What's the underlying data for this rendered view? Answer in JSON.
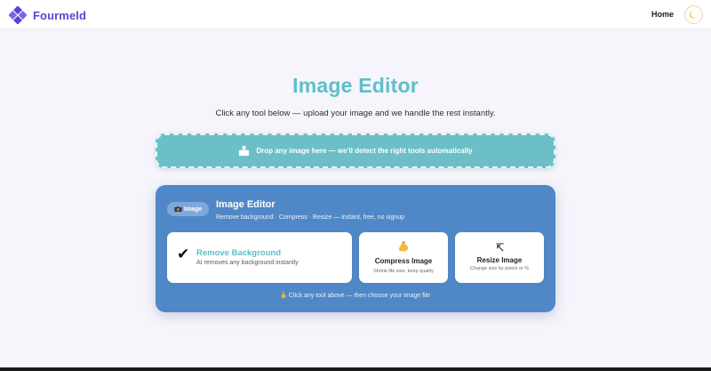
{
  "navbar": {
    "brand_name": "Fourmeld",
    "home_label": "Home"
  },
  "hero": {
    "title": "Image Editor",
    "subtitle": "Click any tool below — upload your image and we handle the rest instantly."
  },
  "dropzone": {
    "text": "Drop any image here — we'll detect the right tools automatically"
  },
  "panel": {
    "badge": "Image",
    "title": "Image Editor",
    "description": "Remove background · Compress · Resize — instant, free, no signup",
    "hint": "Click any tool above — then choose your image file",
    "tools": [
      {
        "title": "Remove Background",
        "description": "AI removes any background instantly",
        "icon": "check-mark-icon"
      },
      {
        "title": "Compress Image",
        "description": "Shrink file size, keep quality",
        "icon": "flexed-biceps-icon"
      },
      {
        "title": "Resize Image",
        "description": "Change size by pixels or %",
        "icon": "resize-arrow-icon"
      }
    ]
  },
  "colors": {
    "brand": "#5b43d9",
    "accent_teal": "#5dbfc8",
    "panel_blue": "#5088c7",
    "dropzone_teal": "#6cbfc6",
    "background": "#f6f5fb"
  }
}
